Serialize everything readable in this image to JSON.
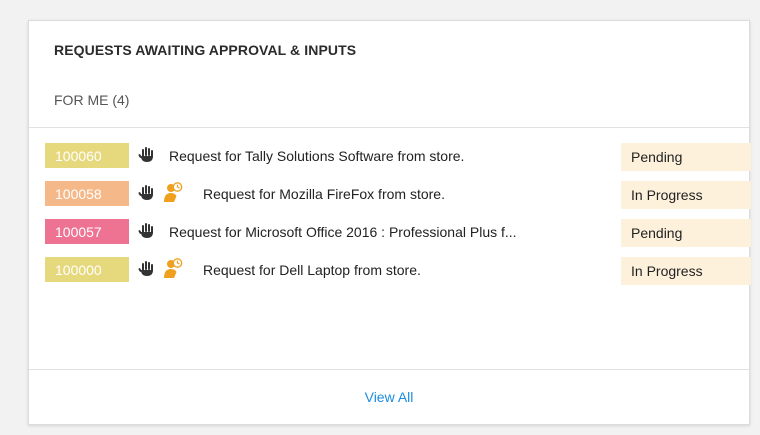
{
  "widget": {
    "title": "REQUESTS AWAITING APPROVAL & INPUTS",
    "filter_label": "FOR ME (4)",
    "view_all_label": "View All",
    "link_color": "#1a8ce0",
    "status_bg": "#fdf1dc"
  },
  "requests": [
    {
      "id": "100060",
      "id_color": "#e6d87c",
      "description": "Request for Tally Solutions Software from store.",
      "status": "Pending",
      "icons": [
        "hand-icon"
      ]
    },
    {
      "id": "100058",
      "id_color": "#f5b989",
      "description": "Request for Mozilla FireFox from store.",
      "status": "In Progress",
      "icons": [
        "hand-icon",
        "user-clock-icon"
      ]
    },
    {
      "id": "100057",
      "id_color": "#ee7393",
      "description": "Request for Microsoft Office 2016 : Professional Plus f...",
      "status": "Pending",
      "icons": [
        "hand-icon"
      ]
    },
    {
      "id": "100000",
      "id_color": "#e6d87c",
      "description": "Request for Dell Laptop from store.",
      "status": "In Progress",
      "icons": [
        "hand-icon",
        "user-clock-icon"
      ]
    }
  ]
}
